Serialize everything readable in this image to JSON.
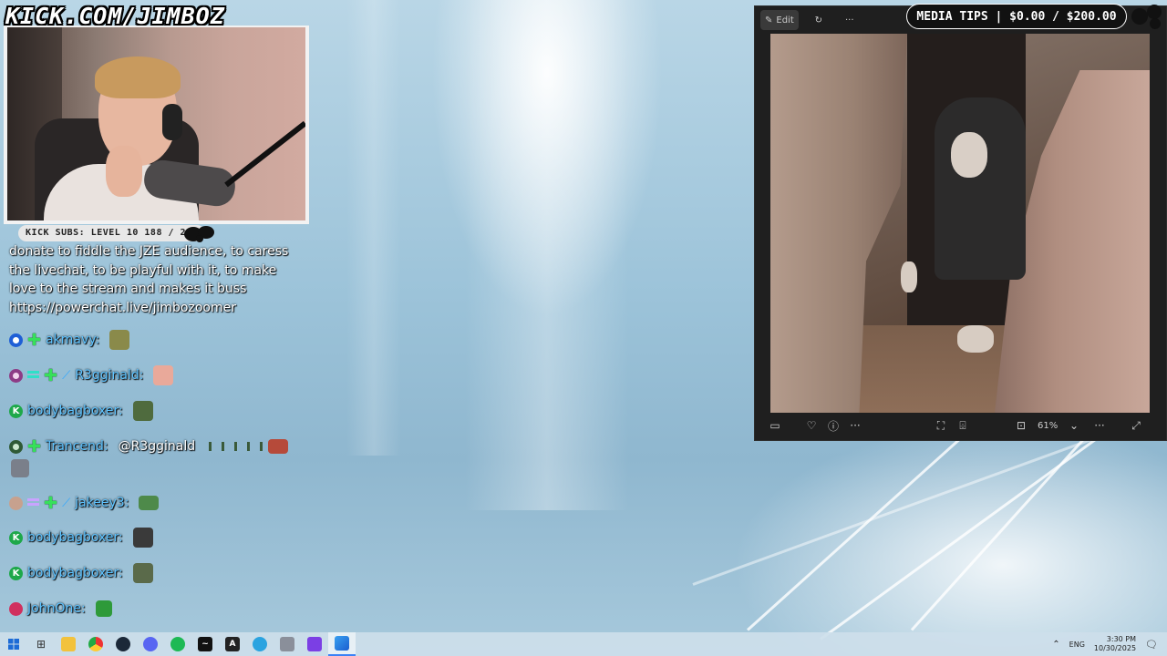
{
  "overlay": {
    "brand": "KICK.COM/JIMBOZ",
    "subs_label": "KICK SUBS: LEVEL 10 188 / 200",
    "media_tips": "MEDIA TIPS | $0.00 / $200.00"
  },
  "chat": {
    "donate_message": "donate to fiddle the JZE audience, to caress the livechat, to be playful with it, to make love to the stream and makes it buss https://powerchat.live/jimbozoomer",
    "rows": [
      {
        "user": "akmavy:",
        "mention": ""
      },
      {
        "user": "R3gginald:",
        "mention": ""
      },
      {
        "user": "bodybagboxer:",
        "mention": ""
      },
      {
        "user": "Trancend:",
        "mention": "@R3gginald"
      },
      {
        "user": "jakeey3:",
        "mention": ""
      },
      {
        "user": "bodybagboxer:",
        "mention": ""
      },
      {
        "user": "bodybagboxer:",
        "mention": ""
      },
      {
        "user": "JohnOne:",
        "mention": ""
      }
    ]
  },
  "photos_app": {
    "edit_label": "Edit",
    "more_label": "···",
    "zoom": "61%"
  },
  "taskbar": {
    "lang": "ENG",
    "time": "3:30 PM",
    "date": "10/30/2025"
  },
  "colors": {
    "chat_name": "#5ec3ff",
    "kick_green": "#1ea84a",
    "accent": "#3b82f6"
  }
}
